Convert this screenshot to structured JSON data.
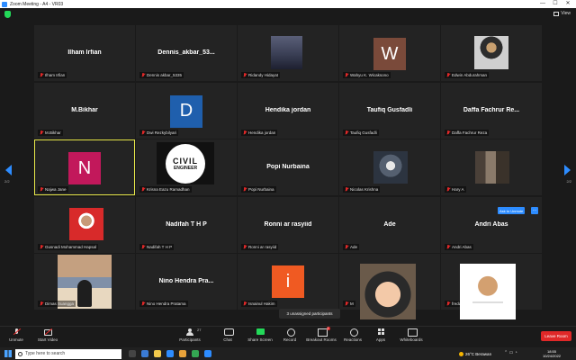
{
  "window": {
    "title": "Zoom Meeting - A4 - VR03",
    "controls": [
      "—",
      "☐",
      "✕"
    ]
  },
  "header": {
    "view_label": "View"
  },
  "pagination": {
    "left": "2/2",
    "right": "2/2"
  },
  "tiles": [
    {
      "display": "Ilham Irfian",
      "name": "Ilham Irfian"
    },
    {
      "display": "Dennis_akbar_53...",
      "name": "Dennis akbar_5335"
    },
    {
      "display": "",
      "name": "Ridandy Hidayat"
    },
    {
      "display": "",
      "letter": "W",
      "name": "Wahyu K. Wicaksono"
    },
    {
      "display": "",
      "name": "Edwin Abdurahman"
    },
    {
      "display": "M.Bikhar",
      "name": "M.Bikhar"
    },
    {
      "display": "",
      "letter": "D",
      "name": "Dwi Rezkybilyari"
    },
    {
      "display": "Hendika jordan",
      "name": "Hendika jordan"
    },
    {
      "display": "Taufiq Gusfadli",
      "name": "Taufiq Gusfadli"
    },
    {
      "display": "Daffa Fachrur Re...",
      "name": "Daffa Fachrur Reza"
    },
    {
      "display": "",
      "letter": "N",
      "name": "Najwa Jane"
    },
    {
      "display": "",
      "logo_line1": "CIVIL",
      "logo_line2": "ENGINEER",
      "name": "Krisna Eazu Ramadhan"
    },
    {
      "display": "Popi Nurbaina",
      "name": "Popi Nurbaina"
    },
    {
      "display": "",
      "name": "Nicolas Krishna"
    },
    {
      "display": "",
      "name": "Hary A"
    },
    {
      "display": "",
      "name": "Gusnadi Mohammad Hapsal"
    },
    {
      "display": "Nadifah T H P",
      "name": "Nadifah T H P"
    },
    {
      "display": "Ronni ar rasyiid",
      "name": "Ronni ar rasyiid"
    },
    {
      "display": "Ade",
      "name": "Ade"
    },
    {
      "display": "Andri Abas",
      "name": "Andri Abas"
    },
    {
      "display": "",
      "name": "Dimas Suangga"
    },
    {
      "display": "Nino Hendra Pra...",
      "name": "Nino Hendra Pratama"
    },
    {
      "display": "",
      "letter": "i",
      "name": "Isnainul Hakim"
    },
    {
      "display": "",
      "name": "M"
    },
    {
      "display": "",
      "name": "freddy suha"
    }
  ],
  "colors": {
    "accent": "#2d8cff",
    "active_speaker": "#e8e84a",
    "avatar_w": "#7a4a3a",
    "avatar_d": "#1f5fad",
    "avatar_n": "#c2185b",
    "avatar_i": "#f05a22",
    "leave": "#e02828"
  },
  "overlays": {
    "unassigned": "3 unassigned participants",
    "ask_unmute": "Ask to Unmute",
    "more": "···"
  },
  "toolbar": {
    "unmute": "Unmute",
    "start_video": "Start Video",
    "participants": "Participants",
    "participants_count": "27",
    "chat": "Chat",
    "share": "Share Screen",
    "record": "Record",
    "breakout": "Breakout Rooms",
    "breakout_badge": "4",
    "reactions": "Reactions",
    "apps": "Apps",
    "whiteboards": "Whiteboards",
    "leave": "Leave Room"
  },
  "taskbar": {
    "search_placeholder": "Type here to search",
    "weather": "26°C Berawan",
    "time": "18:55",
    "date": "10/24/2022"
  }
}
